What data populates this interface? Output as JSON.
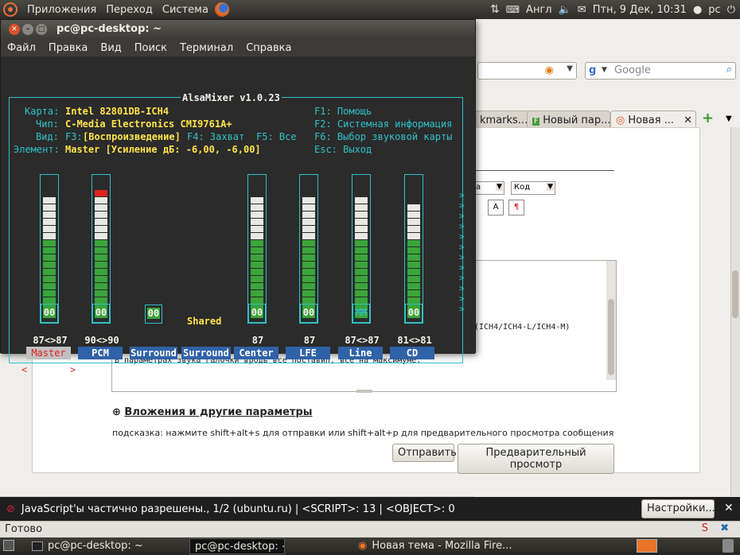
{
  "panel": {
    "menu": [
      "Приложения",
      "Переход",
      "Система"
    ],
    "keyboard": "Англ",
    "datetime": "Птн, 9 Дек, 10:31",
    "user": "pc"
  },
  "terminal": {
    "title": "pc@pc-desktop: ~",
    "menu": [
      "Файл",
      "Правка",
      "Вид",
      "Поиск",
      "Терминал",
      "Справка"
    ]
  },
  "alsamixer": {
    "header": "AlsaMixer v1.0.23",
    "card_label": "Карта:",
    "card_value": "Intel 82801DB-ICH4",
    "chip_label": "Чип:",
    "chip_value": "C-Media Electronics CMI9761A+",
    "view_label": "Вид:",
    "view_f3": "F3:",
    "view_current": "[Воспроизведение]",
    "view_f4": "F4: Захват",
    "view_f5": "F5: Все",
    "element_label": "Элемент:",
    "element_value": "Master [Усиление дБ: -6,00, -6,00]",
    "help_f1": "F1: Помощь",
    "help_f2": "F2: Системная информация",
    "help_f6": "F6: Выбор звуковой карты",
    "help_esc": "Esc: Выход",
    "shared_label": "Shared",
    "channels": [
      {
        "name": "Master",
        "levels": "87<>87",
        "state": "00",
        "fill": 0.87,
        "selected": true
      },
      {
        "name": "PCM",
        "levels": "90<>90",
        "state": "00",
        "fill": 0.9
      },
      {
        "name": "Surround",
        "levels": "",
        "state": "00",
        "fill": null
      },
      {
        "name": "Surround",
        "levels": "",
        "state": "",
        "fill": null
      },
      {
        "name": "Center",
        "levels": "87",
        "state": "00",
        "fill": 0.87
      },
      {
        "name": "LFE",
        "levels": "87",
        "state": "00",
        "fill": 0.87
      },
      {
        "name": "Line",
        "levels": "87<>87",
        "state": "MM",
        "fill": 0.87
      },
      {
        "name": "CD",
        "levels": "81<>81",
        "state": "00",
        "fill": 0.81
      }
    ]
  },
  "firefox": {
    "search_placeholder": "Google",
    "tabs": [
      "kmarks....",
      "Новый пар...",
      "Новая ..."
    ],
    "select1": "а",
    "select2": "Код",
    "editor_line1": "(ICH4/ICH4-L/ICH4-M)",
    "editor_line2": "В параметрах звука галочки вродь все поставил, все на максимуме.",
    "attachments_label": "Вложения и другие параметры",
    "hint": "подсказка: нажмите shift+alt+s для отправки или shift+alt+p для предварительного просмотра сообщения",
    "send_button": "Отправить",
    "preview_button": "Предварительный просмотр",
    "notification": "JavaScript'ы частично разрешены., 1/2 (ubuntu.ru) | <SCRIPT>: 13 | <OBJECT>: 0",
    "settings_button": "Настройки...",
    "status": "Готово"
  },
  "taskbar": {
    "items": [
      "pc@pc-desktop: ~",
      "pc@pc-desktop: ~",
      "Новая тема - Mozilla Fire..."
    ]
  }
}
